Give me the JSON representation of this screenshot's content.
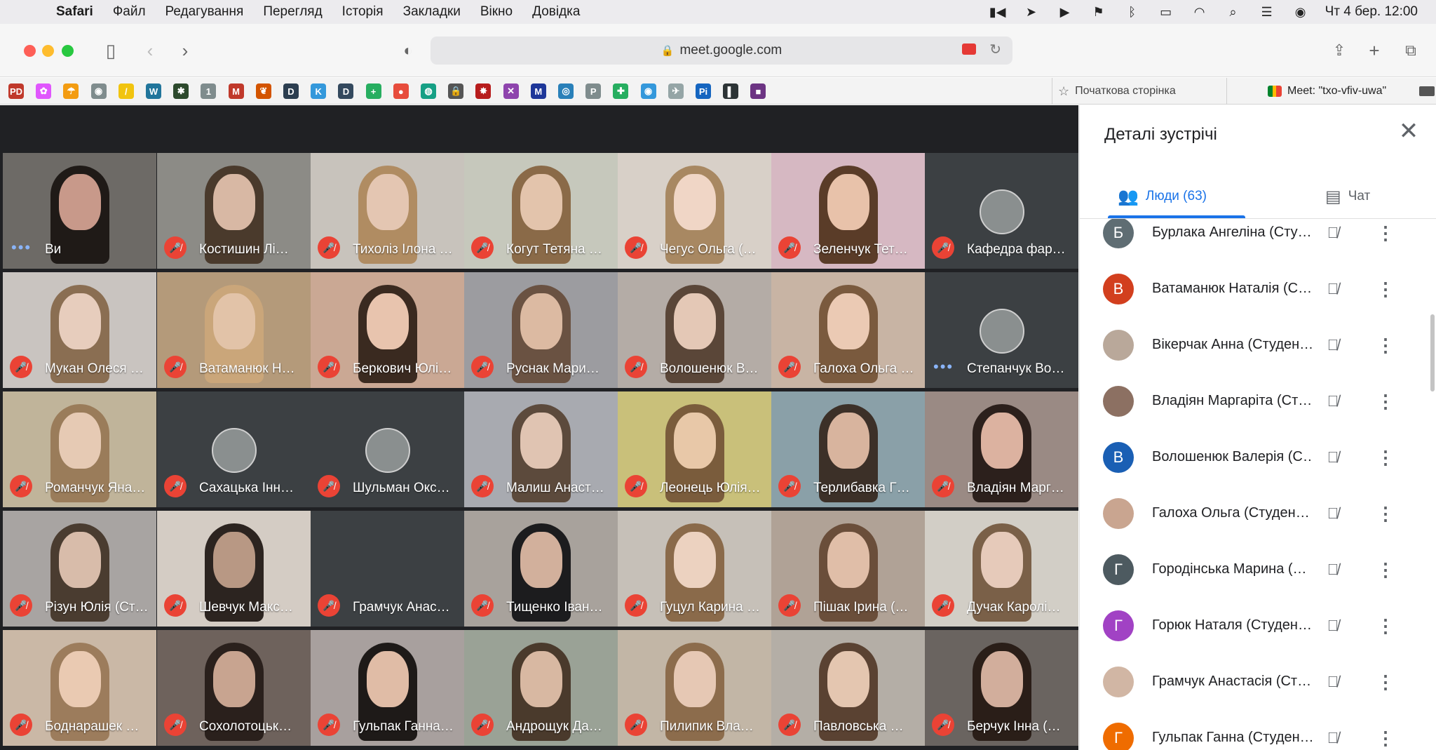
{
  "menubar": {
    "app": "Safari",
    "items": [
      "Файл",
      "Редагування",
      "Перегляд",
      "Історія",
      "Закладки",
      "Вікно",
      "Довідка"
    ],
    "clock": "Чт 4 бер.  12:00"
  },
  "toolbar": {
    "url": "meet.google.com"
  },
  "bookmarks": {
    "start_page": "Початкова сторінка",
    "meet_tab": "Meet: \"txo-vfiv-uwa\"",
    "icons": [
      {
        "label": "PD",
        "color": "#c0392b"
      },
      {
        "label": "✿",
        "color": "#e056fd"
      },
      {
        "label": "☂",
        "color": "#f39c12"
      },
      {
        "label": "◉",
        "color": "#7f8c8d"
      },
      {
        "label": "/",
        "color": "#f1c40f"
      },
      {
        "label": "W",
        "color": "#21759b"
      },
      {
        "label": "✱",
        "color": "#2d4a2d"
      },
      {
        "label": "1",
        "color": "#7f8c8d"
      },
      {
        "label": "M",
        "color": "#c0392b"
      },
      {
        "label": "❦",
        "color": "#d35400"
      },
      {
        "label": "D",
        "color": "#2c3e50"
      },
      {
        "label": "K",
        "color": "#3498db"
      },
      {
        "label": "D",
        "color": "#34495e"
      },
      {
        "label": "+",
        "color": "#27ae60"
      },
      {
        "label": "●",
        "color": "#e74c3c"
      },
      {
        "label": "◍",
        "color": "#16a085"
      },
      {
        "label": "🔒",
        "color": "#555555"
      },
      {
        "label": "✸",
        "color": "#b71c1c"
      },
      {
        "label": "✕",
        "color": "#8e44ad"
      },
      {
        "label": "M",
        "color": "#1e3799"
      },
      {
        "label": "◎",
        "color": "#2980b9"
      },
      {
        "label": "P",
        "color": "#7f8c8d"
      },
      {
        "label": "✚",
        "color": "#27ae60"
      },
      {
        "label": "◉",
        "color": "#3498db"
      },
      {
        "label": "✈",
        "color": "#95a5a6"
      },
      {
        "label": "Pi",
        "color": "#1565c0"
      },
      {
        "label": "▌",
        "color": "#2d3436"
      },
      {
        "label": "■",
        "color": "#6c3483"
      }
    ]
  },
  "grid": {
    "tiles": [
      {
        "name": "Ви",
        "status": "dots",
        "kind": "video",
        "bg": "#6d6a66",
        "hair": "#1f1a17",
        "face": "#c8998a",
        "active": true
      },
      {
        "name": "Костишин Лі…",
        "status": "muted",
        "kind": "video",
        "bg": "#8c8b86",
        "hair": "#4a3a2c",
        "face": "#d8b8a4"
      },
      {
        "name": "Тихоліз Ілона …",
        "status": "muted",
        "kind": "video",
        "bg": "#c8c3bc",
        "hair": "#b08c62",
        "face": "#e4c6b2"
      },
      {
        "name": "Когут Тетяна …",
        "status": "muted",
        "kind": "video",
        "bg": "#c6c8bc",
        "hair": "#8a6a48",
        "face": "#e3c4ac"
      },
      {
        "name": "Чегус Ольга (…",
        "status": "muted",
        "kind": "video",
        "bg": "#d8d0c8",
        "hair": "#a88862",
        "face": "#f0d6c6"
      },
      {
        "name": "Зеленчук Тет…",
        "status": "muted",
        "kind": "video",
        "bg": "#d6b8c2",
        "hair": "#5a3c28",
        "face": "#e8c2aa"
      },
      {
        "name": "Кафедра фар…",
        "status": "muted",
        "kind": "avatar"
      },
      {
        "name": "Мукан Олеся …",
        "status": "muted",
        "kind": "video",
        "bg": "#c9c4c0",
        "hair": "#8a6e52",
        "face": "#e7cdbd"
      },
      {
        "name": "Ватаманюк Н…",
        "status": "muted",
        "kind": "video",
        "bg": "#b49a7a",
        "hair": "#caa67a",
        "face": "#e2c3a8"
      },
      {
        "name": "Беркович Юлі…",
        "status": "muted",
        "kind": "video",
        "bg": "#caa894",
        "hair": "#3a2a20",
        "face": "#e8c4ae"
      },
      {
        "name": "Руснак Мари…",
        "status": "muted",
        "kind": "video",
        "bg": "#9c9ca0",
        "hair": "#6a5242",
        "face": "#dcbaa2"
      },
      {
        "name": "Волошенюк В…",
        "status": "muted",
        "kind": "video",
        "bg": "#b4aca6",
        "hair": "#5a4638",
        "face": "#e4c8b6"
      },
      {
        "name": "Галоха Ольга …",
        "status": "muted",
        "kind": "video",
        "bg": "#c8b4a4",
        "hair": "#7a5a3e",
        "face": "#ebcab4"
      },
      {
        "name": "Степанчук Во…",
        "status": "dots",
        "kind": "avatar"
      },
      {
        "name": "Романчук Яна…",
        "status": "muted",
        "kind": "video",
        "bg": "#c0b49a",
        "hair": "#9a7c5a",
        "face": "#e6cab4"
      },
      {
        "name": "Сахацька Інн…",
        "status": "muted",
        "kind": "avatar"
      },
      {
        "name": "Шульман Окс…",
        "status": "muted",
        "kind": "avatar"
      },
      {
        "name": "Малиш Анаст…",
        "status": "muted",
        "kind": "video",
        "bg": "#a8aab0",
        "hair": "#5c4a3c",
        "face": "#e0c4b2"
      },
      {
        "name": "Леонець Юлія…",
        "status": "muted",
        "kind": "video",
        "bg": "#c9c07a",
        "hair": "#7a5c3c",
        "face": "#e8c8a8"
      },
      {
        "name": "Терлибавка Г…",
        "status": "muted",
        "kind": "video",
        "bg": "#8aa0a8",
        "hair": "#3c3028",
        "face": "#d8b49e"
      },
      {
        "name": "Владіян Марг…",
        "status": "muted",
        "kind": "video",
        "bg": "#9a8a84",
        "hair": "#2c201c",
        "face": "#dcb2a0"
      },
      {
        "name": "Різун Юлія (Ст…",
        "status": "muted",
        "kind": "video",
        "bg": "#a8a4a2",
        "hair": "#4a3c30",
        "face": "#d8bcaa"
      },
      {
        "name": "Шевчук Макс…",
        "status": "muted",
        "kind": "video",
        "bg": "#d4ccc4",
        "hair": "#2c2420",
        "face": "#b89884"
      },
      {
        "name": "Грамчук Анас…",
        "status": "muted",
        "kind": "blank"
      },
      {
        "name": "Тищенко Іван…",
        "status": "muted",
        "kind": "video",
        "bg": "#a8a29c",
        "hair": "#1c1c1e",
        "face": "#d2b09c"
      },
      {
        "name": "Гуцул Карина …",
        "status": "muted",
        "kind": "video",
        "bg": "#c6c0b8",
        "hair": "#8a6a4a",
        "face": "#ecd2c0"
      },
      {
        "name": "Пішак Ірина (…",
        "status": "muted",
        "kind": "video",
        "bg": "#b0a296",
        "hair": "#6a4e3a",
        "face": "#e0bea8"
      },
      {
        "name": "Дучак Каролі…",
        "status": "muted",
        "kind": "video",
        "bg": "#d2cec6",
        "hair": "#7a6048",
        "face": "#e6caba"
      },
      {
        "name": "Боднарашек …",
        "status": "muted",
        "kind": "video",
        "bg": "#cab8a6",
        "hair": "#9c7c5c",
        "face": "#eacab2"
      },
      {
        "name": "Сохолотоцьк…",
        "status": "muted",
        "kind": "video",
        "bg": "#6e625c",
        "hair": "#2a201c",
        "face": "#c8a490"
      },
      {
        "name": "Гульпак Ганна…",
        "status": "muted",
        "kind": "video",
        "bg": "#a8a09e",
        "hair": "#1e1a18",
        "face": "#e0bca6"
      },
      {
        "name": "Андрощук Да…",
        "status": "muted",
        "kind": "video",
        "bg": "#9aa296",
        "hair": "#4a3a2c",
        "face": "#d8b8a2"
      },
      {
        "name": "Пилипик Вла…",
        "status": "muted",
        "kind": "video",
        "bg": "#c2b6a6",
        "hair": "#8c6c4c",
        "face": "#e6c8b4"
      },
      {
        "name": "Павловська …",
        "status": "muted",
        "kind": "video",
        "bg": "#b4aea6",
        "hair": "#5a4232",
        "face": "#e4c6b0"
      },
      {
        "name": "Берчук Інна (…",
        "status": "muted",
        "kind": "video",
        "bg": "#6a6460",
        "hair": "#2a1e18",
        "face": "#d2ae9c"
      }
    ]
  },
  "panel": {
    "title": "Деталі зустрічі",
    "tab_people": "Люди (63)",
    "tab_chat": "Чат",
    "people": [
      {
        "name": "Бурлака Ангеліна (Сту…",
        "initial": "Б",
        "color": "#5f6d73"
      },
      {
        "name": "Ватаманюк Наталія (С…",
        "initial": "В",
        "color": "#d23f1e"
      },
      {
        "name": "Вікерчак Анна (Студен…",
        "initial": "",
        "color": "#b9a89a"
      },
      {
        "name": "Владіян Маргаріта (Ст…",
        "initial": "",
        "color": "#8c7062"
      },
      {
        "name": "Волошенюк Валерія (С…",
        "initial": "В",
        "color": "#1a5fb4"
      },
      {
        "name": "Галоха Ольга (Студен…",
        "initial": "",
        "color": "#c9a590"
      },
      {
        "name": "Городінська Марина (…",
        "initial": "Г",
        "color": "#4d5a60"
      },
      {
        "name": "Горюк Наталя (Студен…",
        "initial": "Г",
        "color": "#a142c4"
      },
      {
        "name": "Грамчук Анастасія (Ст…",
        "initial": "",
        "color": "#d1b6a4"
      },
      {
        "name": "Гульпак Ганна (Студен…",
        "initial": "Г",
        "color": "#ef6c00"
      }
    ]
  }
}
